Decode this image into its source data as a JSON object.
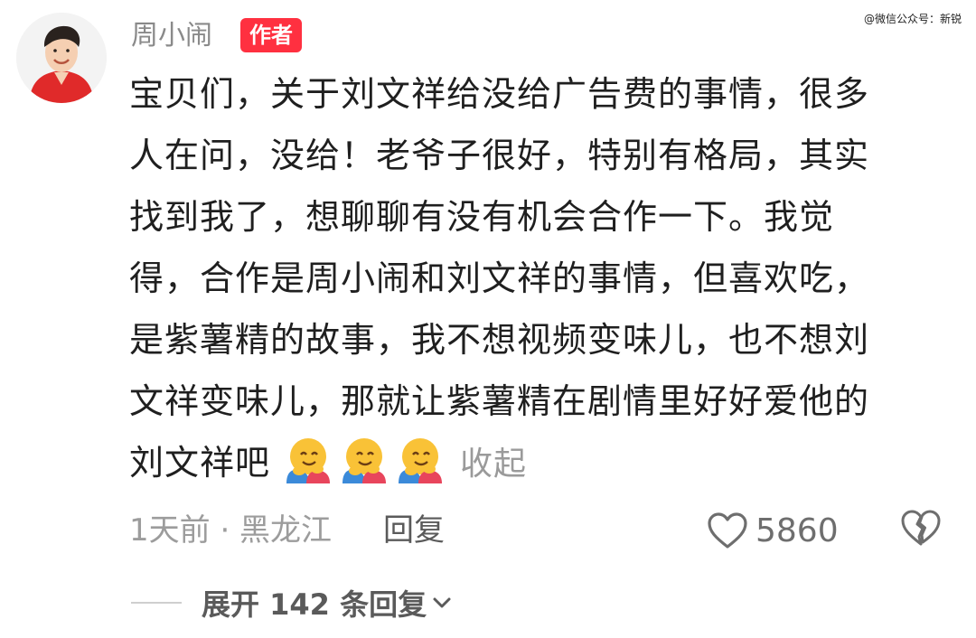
{
  "watermark": "@微信公众号：新锐",
  "comment": {
    "author": "周小闹",
    "author_badge": "作者",
    "text_lines": [
      "宝贝们，关于刘文祥给没给广告费的事情，很多",
      "人在问，没给！老爷子很好，特别有格局，其实",
      "找到我了，想聊聊有没有机会合作一下。我觉",
      "得，合作是周小闹和刘文祥的事情，但喜欢吃，",
      "是紫薯精的故事，我不想视频变味儿，也不想刘",
      "文祥变味儿，那就让紫薯精在剧情里好好爱他的",
      "刘文祥吧"
    ],
    "emojis": [
      "hugging-face-emoji",
      "hugging-face-emoji",
      "hugging-face-emoji"
    ],
    "collapse_label": "收起",
    "meta": "1天前 · 黑龙江",
    "reply_label": "回复",
    "like_count": "5860",
    "expand_label": "展开 142 条回复"
  },
  "colors": {
    "badge": "#ff3040",
    "text": "#1f1f1f",
    "muted": "#9c9c9c",
    "avatar_clothing": "#e02a2a"
  }
}
